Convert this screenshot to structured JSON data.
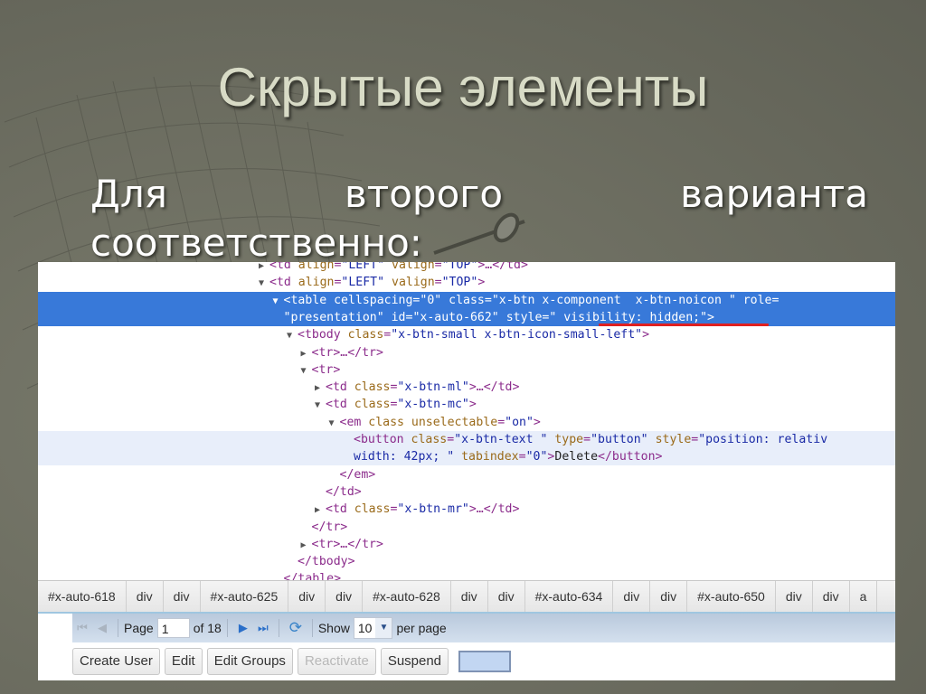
{
  "slide": {
    "title": "Скрытые элементы",
    "subtitle_words": [
      "Для",
      "второго",
      "варианта"
    ],
    "subtitle_line2": "соответственно:"
  },
  "devtools": {
    "lines": [
      {
        "indent": 0,
        "toggle": "▶",
        "parts": [
          [
            "tag",
            "<td "
          ],
          [
            "attr",
            "align"
          ],
          [
            "tag",
            "="
          ],
          [
            "val",
            "\"LEFT\""
          ],
          [
            "tag",
            " "
          ],
          [
            "attr",
            "valign"
          ],
          [
            "tag",
            "="
          ],
          [
            "val",
            "\"TOP\""
          ],
          [
            "tag",
            ">…</td>"
          ]
        ]
      },
      {
        "indent": 0,
        "toggle": "▼",
        "parts": [
          [
            "tag",
            "<td "
          ],
          [
            "attr",
            "align"
          ],
          [
            "tag",
            "="
          ],
          [
            "val",
            "\"LEFT\""
          ],
          [
            "tag",
            " "
          ],
          [
            "attr",
            "valign"
          ],
          [
            "tag",
            "="
          ],
          [
            "val",
            "\"TOP\""
          ],
          [
            "tag",
            ">"
          ]
        ]
      },
      {
        "indent": 1,
        "toggle": "▼",
        "selected": true,
        "parts": [
          [
            "tag",
            "<table "
          ],
          [
            "attr",
            "cellspacing"
          ],
          [
            "tag",
            "="
          ],
          [
            "val",
            "\"0\""
          ],
          [
            "tag",
            " "
          ],
          [
            "attr",
            "class"
          ],
          [
            "tag",
            "="
          ],
          [
            "val",
            "\"x-btn x-component  x-btn-noicon \""
          ],
          [
            "tag",
            " "
          ],
          [
            "attr",
            "role"
          ],
          [
            "tag",
            "="
          ]
        ]
      },
      {
        "indent": 1,
        "toggle": "",
        "selected": true,
        "cont": true,
        "parts": [
          [
            "val",
            "\"presentation\""
          ],
          [
            "tag",
            " "
          ],
          [
            "attr",
            "id"
          ],
          [
            "tag",
            "="
          ],
          [
            "val",
            "\"x-auto-662\""
          ],
          [
            "tag",
            " "
          ],
          [
            "attr",
            "style"
          ],
          [
            "tag",
            "="
          ],
          [
            "val",
            "\" visibility: hidden;\""
          ],
          [
            "tag",
            ">"
          ]
        ]
      },
      {
        "indent": 2,
        "toggle": "▼",
        "parts": [
          [
            "tag",
            "<tbody "
          ],
          [
            "attr",
            "class"
          ],
          [
            "tag",
            "="
          ],
          [
            "val",
            "\"x-btn-small x-btn-icon-small-left\""
          ],
          [
            "tag",
            ">"
          ]
        ]
      },
      {
        "indent": 3,
        "toggle": "▶",
        "parts": [
          [
            "tag",
            "<tr>…</tr>"
          ]
        ]
      },
      {
        "indent": 3,
        "toggle": "▼",
        "parts": [
          [
            "tag",
            "<tr>"
          ]
        ]
      },
      {
        "indent": 4,
        "toggle": "▶",
        "parts": [
          [
            "tag",
            "<td "
          ],
          [
            "attr",
            "class"
          ],
          [
            "tag",
            "="
          ],
          [
            "val",
            "\"x-btn-ml\""
          ],
          [
            "tag",
            ">…</td>"
          ]
        ]
      },
      {
        "indent": 4,
        "toggle": "▼",
        "parts": [
          [
            "tag",
            "<td "
          ],
          [
            "attr",
            "class"
          ],
          [
            "tag",
            "="
          ],
          [
            "val",
            "\"x-btn-mc\""
          ],
          [
            "tag",
            ">"
          ]
        ]
      },
      {
        "indent": 5,
        "toggle": "▼",
        "parts": [
          [
            "tag",
            "<em "
          ],
          [
            "attr",
            "class unselectable"
          ],
          [
            "tag",
            "="
          ],
          [
            "val",
            "\"on\""
          ],
          [
            "tag",
            ">"
          ]
        ]
      },
      {
        "indent": 6,
        "toggle": "",
        "hover": true,
        "parts": [
          [
            "tag",
            "<button "
          ],
          [
            "attr",
            "class"
          ],
          [
            "tag",
            "="
          ],
          [
            "val",
            "\"x-btn-text \""
          ],
          [
            "tag",
            " "
          ],
          [
            "attr",
            "type"
          ],
          [
            "tag",
            "="
          ],
          [
            "val",
            "\"button\""
          ],
          [
            "tag",
            " "
          ],
          [
            "attr",
            "style"
          ],
          [
            "tag",
            "="
          ],
          [
            "val",
            "\"position: relativ"
          ]
        ]
      },
      {
        "indent": 6,
        "toggle": "",
        "hover": true,
        "cont": true,
        "parts": [
          [
            "val",
            "width: 42px; \""
          ],
          [
            "tag",
            " "
          ],
          [
            "attr",
            "tabindex"
          ],
          [
            "tag",
            "="
          ],
          [
            "val",
            "\"0\""
          ],
          [
            "tag",
            ">"
          ],
          [
            "txt",
            "Delete"
          ],
          [
            "tag",
            "</button>"
          ]
        ]
      },
      {
        "indent": 5,
        "toggle": "",
        "parts": [
          [
            "tag",
            "</em>"
          ]
        ]
      },
      {
        "indent": 4,
        "toggle": "",
        "parts": [
          [
            "tag",
            "</td>"
          ]
        ]
      },
      {
        "indent": 4,
        "toggle": "▶",
        "parts": [
          [
            "tag",
            "<td "
          ],
          [
            "attr",
            "class"
          ],
          [
            "tag",
            "="
          ],
          [
            "val",
            "\"x-btn-mr\""
          ],
          [
            "tag",
            ">…</td>"
          ]
        ]
      },
      {
        "indent": 3,
        "toggle": "",
        "parts": [
          [
            "tag",
            "</tr>"
          ]
        ]
      },
      {
        "indent": 3,
        "toggle": "▶",
        "parts": [
          [
            "tag",
            "<tr>…</tr>"
          ]
        ]
      },
      {
        "indent": 2,
        "toggle": "",
        "parts": [
          [
            "tag",
            "</tbody>"
          ]
        ]
      },
      {
        "indent": 1,
        "toggle": "",
        "parts": [
          [
            "tag",
            "</table>"
          ]
        ]
      }
    ],
    "breadcrumbs": [
      "#x-auto-618",
      "div",
      "div",
      "#x-auto-625",
      "div",
      "div",
      "#x-auto-628",
      "div",
      "div",
      "#x-auto-634",
      "div",
      "div",
      "#x-auto-650",
      "div",
      "div",
      "a"
    ]
  },
  "app": {
    "pager": {
      "page_label": "Page",
      "page_value": "1",
      "of_label": "of 18",
      "show_label": "Show",
      "show_value": "10",
      "per_page_label": "per page"
    },
    "toolbar": {
      "create_user": "Create User",
      "edit": "Edit",
      "edit_groups": "Edit Groups",
      "reactivate": "Reactivate",
      "suspend": "Suspend"
    }
  },
  "colors": {
    "selection": "#3879d9",
    "underline": "#e02020",
    "tag": "#8b2b8b",
    "attr": "#9a6a1a",
    "value": "#1a2aa6"
  }
}
